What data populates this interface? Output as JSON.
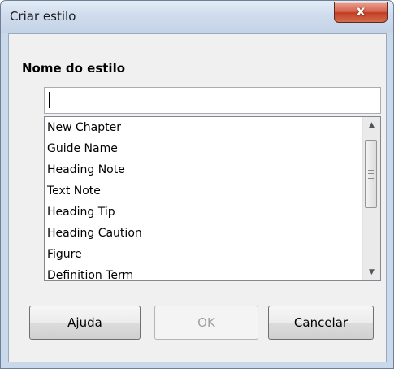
{
  "window": {
    "title": "Criar estilo",
    "close_glyph": "x"
  },
  "form": {
    "name_label": "Nome do estilo",
    "name_value": "",
    "styles": [
      "New Chapter",
      "Guide Name",
      "Heading Note",
      "Text Note",
      "Heading Tip",
      "Heading Caution",
      "Figure",
      "Definition Term"
    ]
  },
  "buttons": {
    "help_pre": "Aj",
    "help_mnemonic": "u",
    "help_post": "da",
    "ok": "OK",
    "cancel": "Cancelar"
  },
  "icons": {
    "close": "close-icon",
    "scroll_up": "scroll-up-arrow-icon",
    "scroll_down": "scroll-down-arrow-icon"
  }
}
